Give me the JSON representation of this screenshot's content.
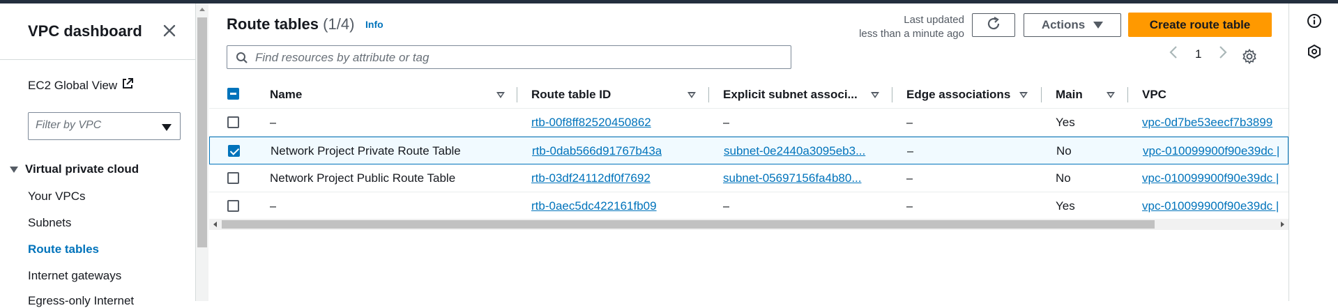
{
  "sidebar": {
    "title": "VPC dashboard",
    "ec2_link": "EC2 Global View",
    "filter_placeholder": "Filter by VPC",
    "section": "Virtual private cloud",
    "items": [
      {
        "label": "Your VPCs"
      },
      {
        "label": "Subnets"
      },
      {
        "label": "Route tables",
        "active": true
      },
      {
        "label": "Internet gateways"
      },
      {
        "label": "Egress-only Internet"
      }
    ]
  },
  "header": {
    "title": "Route tables",
    "count": "(1/4)",
    "info": "Info",
    "last_updated_label": "Last updated",
    "last_updated_value": "less than a minute ago",
    "actions_label": "Actions",
    "create_label": "Create route table"
  },
  "search": {
    "placeholder": "Find resources by attribute or tag"
  },
  "pagination": {
    "page": "1"
  },
  "table": {
    "columns": [
      "Name",
      "Route table ID",
      "Explicit subnet associ...",
      "Edge associations",
      "Main",
      "VPC"
    ],
    "rows": [
      {
        "name": "–",
        "route_table_id": "rtb-00f8ff82520450862",
        "subnet": "–",
        "edge": "–",
        "main": "Yes",
        "vpc": "vpc-0d7be53eecf7b3899",
        "selected": false
      },
      {
        "name": "Network Project Private Route Table",
        "route_table_id": "rtb-0dab566d91767b43a",
        "subnet": "subnet-0e2440a3095eb3...",
        "edge": "–",
        "main": "No",
        "vpc": "vpc-010099900f90e39dc |",
        "selected": true
      },
      {
        "name": "Network Project Public Route Table",
        "route_table_id": "rtb-03df24112df0f7692",
        "subnet": "subnet-05697156fa4b80...",
        "edge": "–",
        "main": "No",
        "vpc": "vpc-010099900f90e39dc |",
        "selected": false
      },
      {
        "name": "–",
        "route_table_id": "rtb-0aec5dc422161fb09",
        "subnet": "–",
        "edge": "–",
        "main": "Yes",
        "vpc": "vpc-010099900f90e39dc |",
        "selected": false
      }
    ]
  },
  "colors": {
    "accent": "#0073bb",
    "primary_button": "#ff9900",
    "top_bar": "#232f3e"
  },
  "icons": [
    "close-icon",
    "external-link-icon",
    "search-icon",
    "refresh-icon",
    "gear-icon",
    "info-icon",
    "feedback-icon"
  ]
}
